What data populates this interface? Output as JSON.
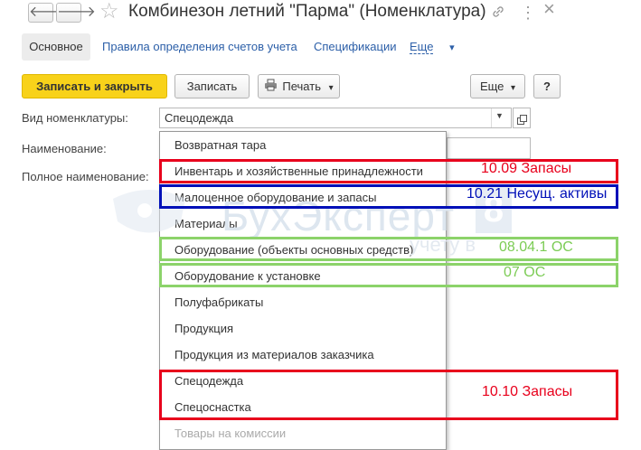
{
  "window": {
    "title": "Комбинезон летний \"Парма\" (Номенклатура)",
    "back_icon": "arrow-left-icon",
    "forward_icon": "arrow-right-icon",
    "favorite_icon": "star-icon",
    "link_icon": "link-icon",
    "menu_icon": "more-vertical-icon",
    "close_icon": "close-icon",
    "glyphs": {
      "back": "🡐",
      "forward": "🡒",
      "star": "☆",
      "link": "🔗",
      "menu": "⋮",
      "close": "×"
    }
  },
  "tabs": {
    "active": "Основное",
    "links": [
      "Правила определения счетов учета",
      "Спецификации"
    ],
    "more": "Еще",
    "more_arrow": "▾"
  },
  "toolbar": {
    "save_close": "Записать и закрыть",
    "save": "Записать",
    "print": "Печать",
    "print_arrow": "▾",
    "more": "Еще",
    "more_arrow": "▾",
    "help": "?"
  },
  "form": {
    "kind_label": "Вид номенклатуры:",
    "kind_value": "Спецодежда",
    "name_label": "Наименование:",
    "full_name_label": "Полное наименование:"
  },
  "dropdown": {
    "items": [
      "Возвратная тара",
      "Инвентарь и хозяйственные принадлежности",
      "Малоценное оборудование и запасы",
      "Материалы",
      "Оборудование (объекты основных средств)",
      "Оборудование к установке",
      "Полуфабрикаты",
      "Продукция",
      "Продукция из материалов заказчика",
      "Спецодежда",
      "Спецоснастка",
      "Товары на комиссии"
    ]
  },
  "watermark": {
    "text": "БухЭксперт",
    "subtext": "учету в",
    "badge": "8"
  },
  "annotations": {
    "inventory": "10.09 Запасы",
    "low_value": "10.21 Несущ. активы",
    "fixed_assets": "08.04.1 ОС",
    "installation": "07 ОС",
    "workwear": "10.10 Запасы"
  },
  "colors": {
    "red": "#e8001c",
    "blue": "#0010b8",
    "green": "#8cd36a",
    "green_text": "#7ccc55",
    "primary_button": "#f8d21a",
    "link": "#2c5fa8"
  }
}
